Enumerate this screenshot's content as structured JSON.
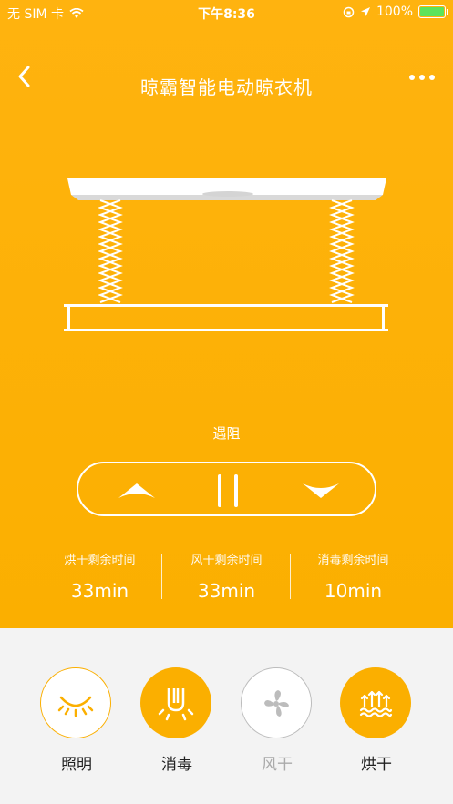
{
  "status_bar": {
    "carrier": "无 SIM 卡",
    "time": "下午8:36",
    "battery": "100%",
    "battery_color": "#5ee35b"
  },
  "header": {
    "title": "晾霸智能电动晾衣机",
    "back_icon": "chevron-left-icon",
    "more_icon": "more-dots-icon"
  },
  "device": {
    "state": "遇阻"
  },
  "controls": {
    "up_icon": "arrow-up-icon",
    "pause_icon": "pause-icon",
    "down_icon": "arrow-down-icon"
  },
  "timers": [
    {
      "label": "烘干剩余时间",
      "value": "33min"
    },
    {
      "label": "风干剩余时间",
      "value": "33min"
    },
    {
      "label": "消毒剩余时间",
      "value": "10min"
    }
  ],
  "functions": [
    {
      "label": "照明",
      "icon": "light-icon",
      "style": "outline"
    },
    {
      "label": "消毒",
      "icon": "uv-disinfect-icon",
      "style": "filled"
    },
    {
      "label": "风干",
      "icon": "fan-icon",
      "style": "disabled"
    },
    {
      "label": "烘干",
      "icon": "heat-dry-icon",
      "style": "filled"
    }
  ],
  "colors": {
    "accent": "#fbaf00",
    "background": "#f3f3f3",
    "disabled": "#bcbcbc"
  }
}
